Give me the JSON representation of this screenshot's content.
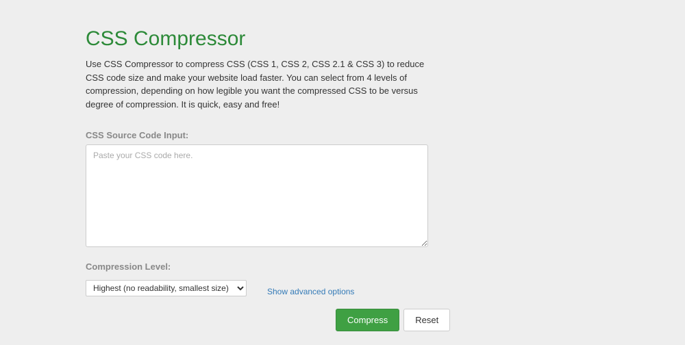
{
  "header": {
    "title": "CSS Compressor",
    "description": "Use CSS Compressor to compress CSS (CSS 1, CSS 2, CSS 2.1 & CSS 3) to reduce CSS code size and make your website load faster. You can select from 4 levels of compression, depending on how legible you want the compressed CSS to be versus degree of compression. It is quick, easy and free!"
  },
  "form": {
    "css_input_label": "CSS Source Code Input:",
    "css_input_placeholder": "Paste your CSS code here.",
    "css_input_value": "",
    "compression_label": "Compression Level:",
    "compression_selected": "Highest (no readability, smallest size)",
    "advanced_link_label": "Show advanced options",
    "compress_button_label": "Compress",
    "reset_button_label": "Reset"
  }
}
